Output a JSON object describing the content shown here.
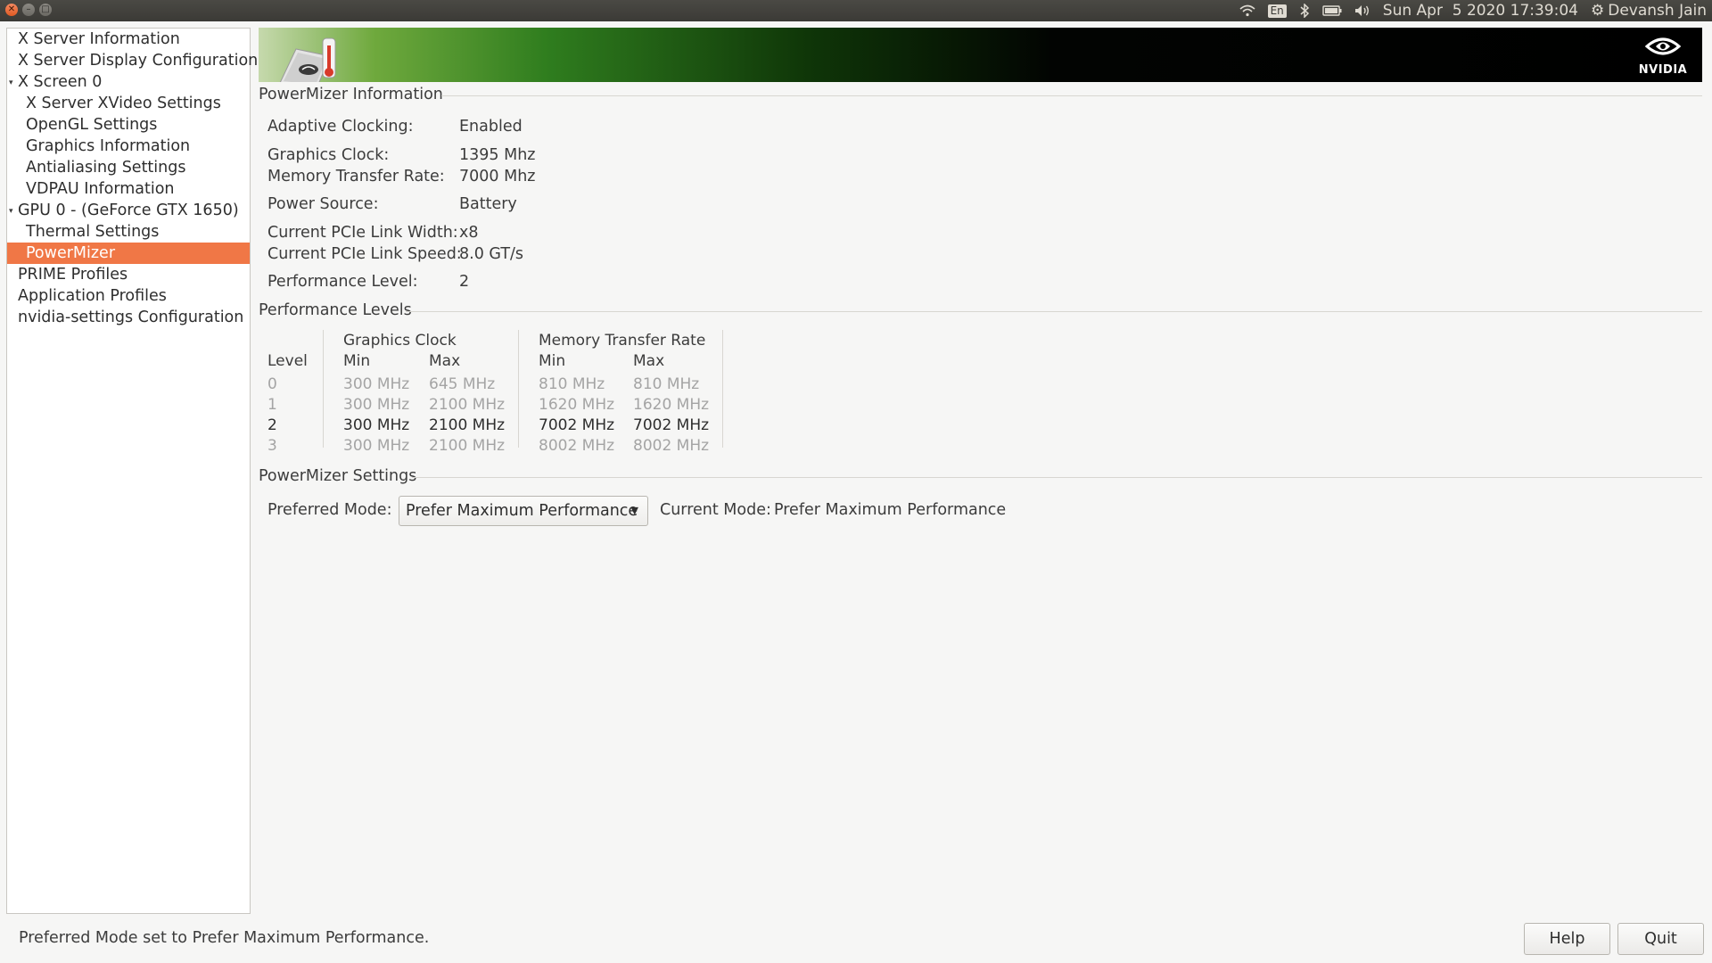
{
  "topbar": {
    "window_controls": [
      "close",
      "minimize",
      "maximize"
    ],
    "tray_icons": [
      "wifi-icon",
      "keyboard-layout-icon",
      "bluetooth-icon",
      "battery-icon",
      "volume-icon"
    ],
    "language": "En",
    "datetime": "Sun Apr  5 2020 17:39:04",
    "user": "Devansh Jain"
  },
  "sidebar": {
    "items": [
      {
        "label": "X Server Information",
        "level": 0
      },
      {
        "label": "X Server Display Configuration",
        "level": 0
      },
      {
        "label": "X Screen 0",
        "level": 0,
        "expanded": true
      },
      {
        "label": "X Server XVideo Settings",
        "level": 1
      },
      {
        "label": "OpenGL Settings",
        "level": 1
      },
      {
        "label": "Graphics Information",
        "level": 1
      },
      {
        "label": "Antialiasing Settings",
        "level": 1
      },
      {
        "label": "VDPAU Information",
        "level": 1
      },
      {
        "label": "GPU 0 - (GeForce GTX 1650)",
        "level": 0,
        "expanded": true
      },
      {
        "label": "Thermal Settings",
        "level": 1
      },
      {
        "label": "PowerMizer",
        "level": 1,
        "selected": true
      },
      {
        "label": "PRIME Profiles",
        "level": 0
      },
      {
        "label": "Application Profiles",
        "level": 0
      },
      {
        "label": "nvidia-settings Configuration",
        "level": 0
      }
    ]
  },
  "banner": {
    "logo_text": "NVIDIA",
    "accent_color": "#76b900"
  },
  "powermizer_info": {
    "title": "PowerMizer Information",
    "rows": [
      {
        "label": "Adaptive Clocking:",
        "value": "Enabled"
      },
      {
        "label": "Graphics Clock:",
        "value": "1395 Mhz"
      },
      {
        "label": "Memory Transfer Rate:",
        "value": "7000 Mhz"
      },
      {
        "label": "Power Source:",
        "value": "Battery"
      },
      {
        "label": "Current PCIe Link Width:",
        "value": "x8"
      },
      {
        "label": "Current PCIe Link Speed:",
        "value": "8.0 GT/s"
      },
      {
        "label": "Performance Level:",
        "value": "2"
      }
    ]
  },
  "performance_levels": {
    "title": "Performance Levels",
    "graphics_clock_header": "Graphics Clock",
    "memory_header": "Memory Transfer Rate",
    "level_header": "Level",
    "min_header": "Min",
    "max_header": "Max",
    "rows": [
      {
        "level": "0",
        "gc_min": "300 MHz",
        "gc_max": "645 MHz",
        "mem_min": "810 MHz",
        "mem_max": "810 MHz",
        "active": false
      },
      {
        "level": "1",
        "gc_min": "300 MHz",
        "gc_max": "2100 MHz",
        "mem_min": "1620 MHz",
        "mem_max": "1620 MHz",
        "active": false
      },
      {
        "level": "2",
        "gc_min": "300 MHz",
        "gc_max": "2100 MHz",
        "mem_min": "7002 MHz",
        "mem_max": "7002 MHz",
        "active": true
      },
      {
        "level": "3",
        "gc_min": "300 MHz",
        "gc_max": "2100 MHz",
        "mem_min": "8002 MHz",
        "mem_max": "8002 MHz",
        "active": false
      }
    ]
  },
  "powermizer_settings": {
    "title": "PowerMizer Settings",
    "preferred_mode_label": "Preferred Mode:",
    "preferred_mode_value": "Prefer Maximum Performance",
    "current_mode_label": "Current Mode:",
    "current_mode_value": "Prefer Maximum Performance"
  },
  "status": "Preferred Mode set to Prefer Maximum Performance.",
  "buttons": {
    "help": "Help",
    "quit": "Quit"
  },
  "colors": {
    "selection": "#f07746",
    "window_bg": "#f6f6f5"
  }
}
